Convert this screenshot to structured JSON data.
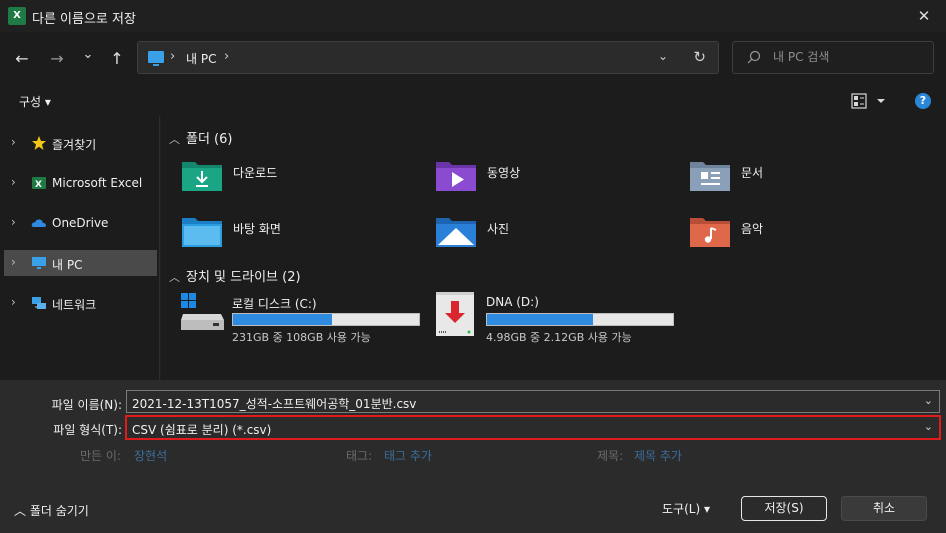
{
  "window": {
    "app_icon_text": "X",
    "title": "다른 이름으로 저장",
    "close_glyph": "✕"
  },
  "navigation": {
    "back_glyph": "←",
    "forward_glyph": "→",
    "recent_glyph": "⌄",
    "up_glyph": "↑",
    "breadcrumb": [
      "내 PC"
    ],
    "crumb_separator": "›",
    "dropdown_glyph": "⌄",
    "refresh_glyph": "↻",
    "search_placeholder": "내 PC 검색"
  },
  "toolbar": {
    "organize_label": "구성 ▾",
    "help_label": "?"
  },
  "sidebar": {
    "chevron": "›",
    "items": [
      {
        "label": "즐겨찾기",
        "icon": "star-icon"
      },
      {
        "label": "Microsoft Excel",
        "icon": "excel-icon"
      },
      {
        "label": "OneDrive",
        "icon": "cloud-icon"
      },
      {
        "label": "내 PC",
        "icon": "computer-icon",
        "selected": true
      },
      {
        "label": "네트워크",
        "icon": "network-icon"
      }
    ]
  },
  "content": {
    "group_chevron": "︿",
    "folders_header": "폴더 (6)",
    "folders": [
      {
        "label": "다운로드",
        "icon": "download-folder-icon",
        "color": "#1aa585"
      },
      {
        "label": "동영상",
        "icon": "video-folder-icon",
        "color": "#8a4bd0"
      },
      {
        "label": "문서",
        "icon": "documents-folder-icon",
        "color": "#8aa0b8"
      },
      {
        "label": "바탕 화면",
        "icon": "desktop-folder-icon",
        "color": "#2a9ee0"
      },
      {
        "label": "사진",
        "icon": "pictures-folder-icon",
        "color": "#2a7fd8"
      },
      {
        "label": "음악",
        "icon": "music-folder-icon",
        "color": "#e0684a"
      }
    ],
    "drives_header": "장치 및 드라이브 (2)",
    "drives": [
      {
        "name": "로컬 디스크 (C:)",
        "info": "231GB 중 108GB 사용 가능",
        "used_fraction": 0.53,
        "icon": "system-drive-icon"
      },
      {
        "name": "DNA (D:)",
        "info": "4.98GB 중 2.12GB 사용 가능",
        "used_fraction": 0.57,
        "icon": "usb-drive-icon"
      }
    ]
  },
  "form": {
    "filename_label": "파일 이름(N):",
    "filename_value": "2021-12-13T1057_성적-소프트웨어공학_01분반.csv",
    "filetype_label": "파일 형식(T):",
    "filetype_value": "CSV (쉼표로 분리) (*.csv)",
    "dropdown_glyph": "⌄",
    "author_label": "만든 이:",
    "author_value": "장현석",
    "tags_label": "태그:",
    "tags_value": "태그 추가",
    "title_label": "제목:",
    "title_value": "제목 추가",
    "highlight_color": "#e01b1b"
  },
  "footer": {
    "hide_folders": "︿  폴더 숨기기",
    "tools": "도구(L)   ▾",
    "save": "저장(S)",
    "cancel": "취소"
  }
}
